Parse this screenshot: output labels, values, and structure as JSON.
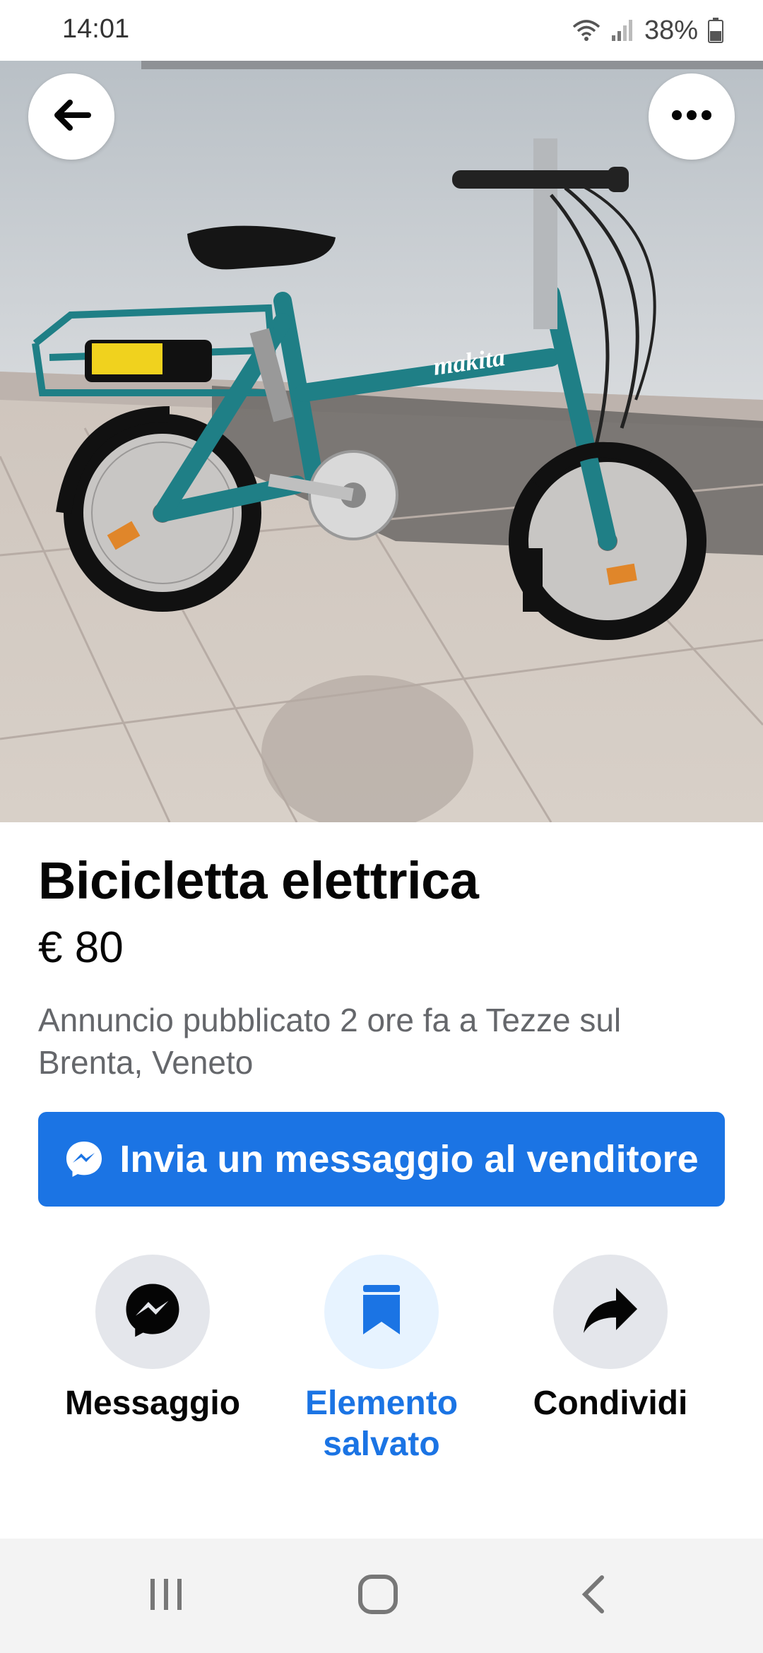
{
  "status_bar": {
    "time": "14:01",
    "battery": "38%",
    "icons": [
      "wifi-icon",
      "signal-icon",
      "battery-icon"
    ]
  },
  "listing": {
    "photo_description_icon": "bicycle-photo",
    "photo_brand_text": "makita",
    "title": "Bicicletta elettrica",
    "price": "€ 80",
    "meta": "Annuncio pubblicato 2 ore fa a Tezze sul Brenta, Veneto"
  },
  "top_actions": {
    "back_icon": "arrow-left-icon",
    "more_icon": "more-horizontal-icon"
  },
  "primary_button": {
    "label": "Invia un messaggio al venditore",
    "icon": "messenger-icon"
  },
  "actions": [
    {
      "label": "Messaggio",
      "icon": "messenger-icon",
      "active": false
    },
    {
      "label": "Elemento salvato",
      "icon": "bookmark-icon",
      "active": true
    },
    {
      "label": "Condividi",
      "icon": "share-icon",
      "active": false
    }
  ],
  "nav_bar": {
    "icons": [
      "recents-icon",
      "home-icon",
      "back-icon"
    ]
  },
  "colors": {
    "accent": "#1b74e4",
    "accent_light": "#e7f3ff",
    "secondary_text": "#65676b",
    "bubble_bg": "#e4e6eb",
    "bike_frame": "#1f7f86"
  }
}
